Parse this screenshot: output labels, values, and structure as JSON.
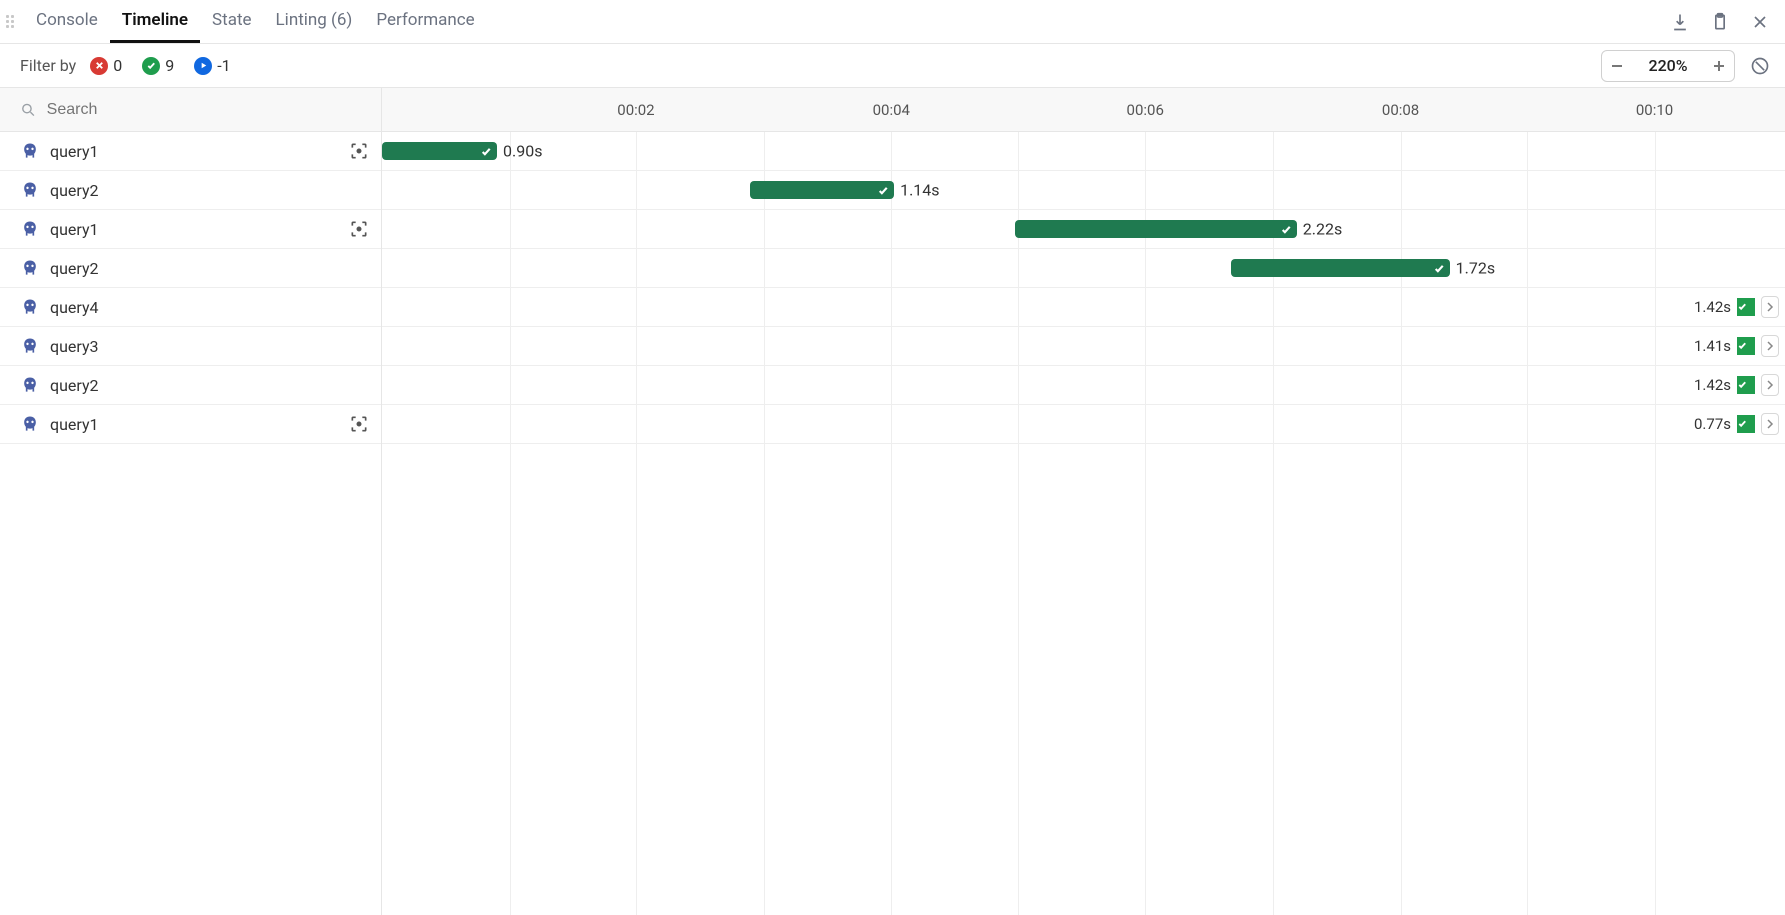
{
  "tabs": {
    "console": "Console",
    "timeline": "Timeline",
    "state": "State",
    "linting": "Linting (6)",
    "performance": "Performance"
  },
  "filter": {
    "label": "Filter by",
    "error_count": "0",
    "success_count": "9",
    "running_count": "-1"
  },
  "zoom": {
    "value": "220%"
  },
  "search": {
    "placeholder": "Search"
  },
  "ruler": {
    "ticks": [
      {
        "pct": 18.1,
        "label": "00:02"
      },
      {
        "pct": 36.3,
        "label": "00:04"
      },
      {
        "pct": 54.4,
        "label": "00:06"
      },
      {
        "pct": 72.6,
        "label": "00:08"
      },
      {
        "pct": 90.7,
        "label": "00:10"
      }
    ],
    "minor_pct": [
      9.1,
      27.2,
      45.3,
      63.5,
      81.6
    ]
  },
  "rows": [
    {
      "name": "query1",
      "focusable": true,
      "bar": {
        "left_pct": 0.0,
        "width_pct": 8.2,
        "dur": "0.90s"
      }
    },
    {
      "name": "query2",
      "focusable": false,
      "bar": {
        "left_pct": 26.2,
        "width_pct": 10.3,
        "dur": "1.14s"
      }
    },
    {
      "name": "query1",
      "focusable": true,
      "bar": {
        "left_pct": 45.1,
        "width_pct": 20.1,
        "dur": "2.22s"
      }
    },
    {
      "name": "query2",
      "focusable": false,
      "bar": {
        "left_pct": 60.5,
        "width_pct": 15.6,
        "dur": "1.72s"
      }
    },
    {
      "name": "query4",
      "focusable": false,
      "edge": {
        "dur": "1.42s"
      }
    },
    {
      "name": "query3",
      "focusable": false,
      "edge": {
        "dur": "1.41s"
      }
    },
    {
      "name": "query2",
      "focusable": false,
      "edge": {
        "dur": "1.42s"
      }
    },
    {
      "name": "query1",
      "focusable": true,
      "edge": {
        "dur": "0.77s"
      }
    }
  ]
}
